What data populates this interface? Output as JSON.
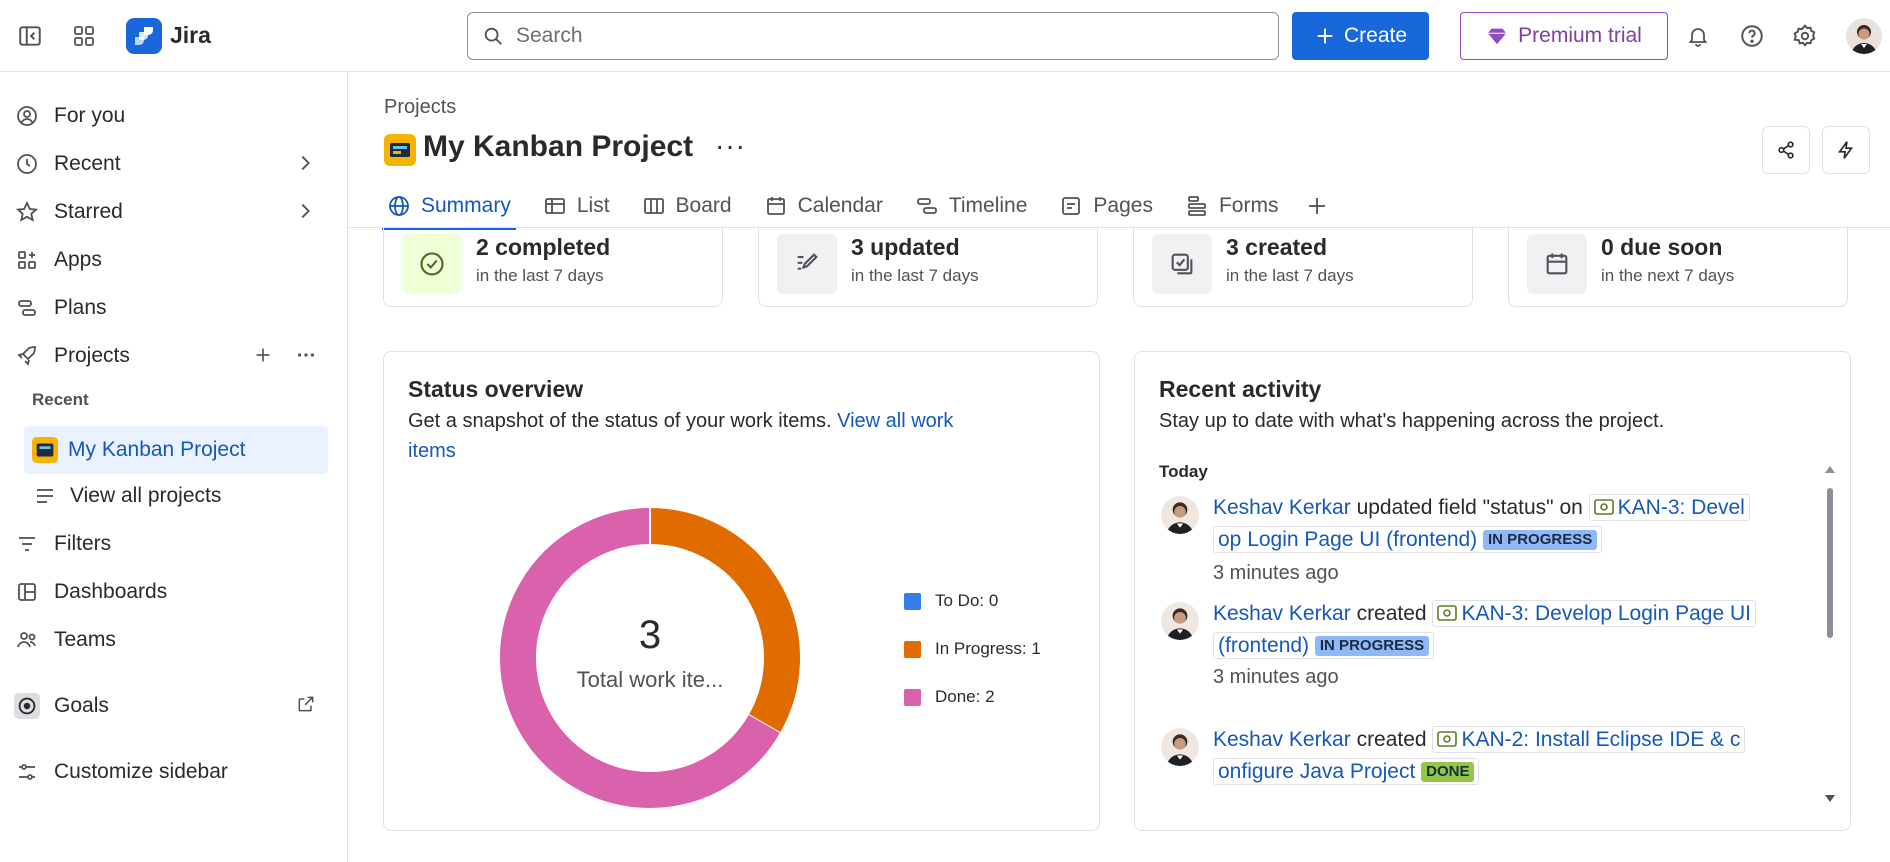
{
  "topbar": {
    "app_name": "Jira",
    "search_placeholder": "Search",
    "create_label": "Create",
    "premium_label": "Premium trial"
  },
  "sidebar": {
    "items": [
      {
        "label": "For you",
        "icon": "user-circle-icon"
      },
      {
        "label": "Recent",
        "icon": "clock-icon"
      },
      {
        "label": "Starred",
        "icon": "star-icon"
      },
      {
        "label": "Apps",
        "icon": "apps-icon"
      },
      {
        "label": "Plans",
        "icon": "plans-icon"
      },
      {
        "label": "Projects",
        "icon": "rocket-icon"
      }
    ],
    "recent_section": "Recent",
    "recent_project": "My Kanban Project",
    "view_all_projects": "View all projects",
    "lower_items": [
      {
        "label": "Filters",
        "icon": "filter-icon"
      },
      {
        "label": "Dashboards",
        "icon": "dashboard-icon"
      },
      {
        "label": "Teams",
        "icon": "teams-icon"
      }
    ],
    "goals": "Goals",
    "customize": "Customize sidebar"
  },
  "main": {
    "breadcrumb": "Projects",
    "project_title": "My Kanban Project",
    "more": "···",
    "tabs": [
      {
        "label": "Summary",
        "active": true
      },
      {
        "label": "List"
      },
      {
        "label": "Board"
      },
      {
        "label": "Calendar"
      },
      {
        "label": "Timeline"
      },
      {
        "label": "Pages"
      },
      {
        "label": "Forms"
      }
    ],
    "stats": [
      {
        "title": "2 completed",
        "sub": "in the last 7 days",
        "icon": "check-circle-icon"
      },
      {
        "title": "3 updated",
        "sub": "in the last 7 days",
        "icon": "edit-icon"
      },
      {
        "title": "3 created",
        "sub": "in the last 7 days",
        "icon": "created-icon"
      },
      {
        "title": "0 due soon",
        "sub": "in the next 7 days",
        "icon": "calendar-icon"
      }
    ],
    "status_overview": {
      "title": "Status overview",
      "desc_prefix": "Get a snapshot of the status of your work items. ",
      "desc_link_1": "View all work",
      "desc_link_2": "items",
      "total": "3",
      "total_label": "Total work ite...",
      "legend": [
        {
          "label": "To Do: 0",
          "color": "#357de8"
        },
        {
          "label": "In Progress: 1",
          "color": "#e06c00"
        },
        {
          "label": "Done: 2",
          "color": "#da62ac"
        }
      ]
    },
    "recent_activity": {
      "title": "Recent activity",
      "desc": "Stay up to date with what's happening across the project.",
      "today": "Today",
      "items": [
        {
          "user": "Keshav Kerkar",
          "action": " updated field \"status\" on ",
          "issue": "KAN-3: Devel",
          "issue2": "op Login Page UI (frontend)",
          "status": "IN PROGRESS",
          "time": "3 minutes ago"
        },
        {
          "user": "Keshav Kerkar",
          "action": " created ",
          "issue": "KAN-3: Develop Login Page UI",
          "issue2": "(frontend)",
          "status": "IN PROGRESS",
          "time": "3 minutes ago"
        },
        {
          "user": "Keshav Kerkar",
          "action": " created ",
          "issue": "KAN-2: Install Eclipse IDE & c",
          "issue2": "onfigure Java Project",
          "status": "DONE",
          "time": ""
        }
      ]
    }
  },
  "chart_data": {
    "type": "pie",
    "categories": [
      "To Do",
      "In Progress",
      "Done"
    ],
    "values": [
      0,
      1,
      2
    ],
    "colors": [
      "#357de8",
      "#e06c00",
      "#da62ac"
    ],
    "center_value": "3",
    "center_label": "Total work ite..."
  }
}
